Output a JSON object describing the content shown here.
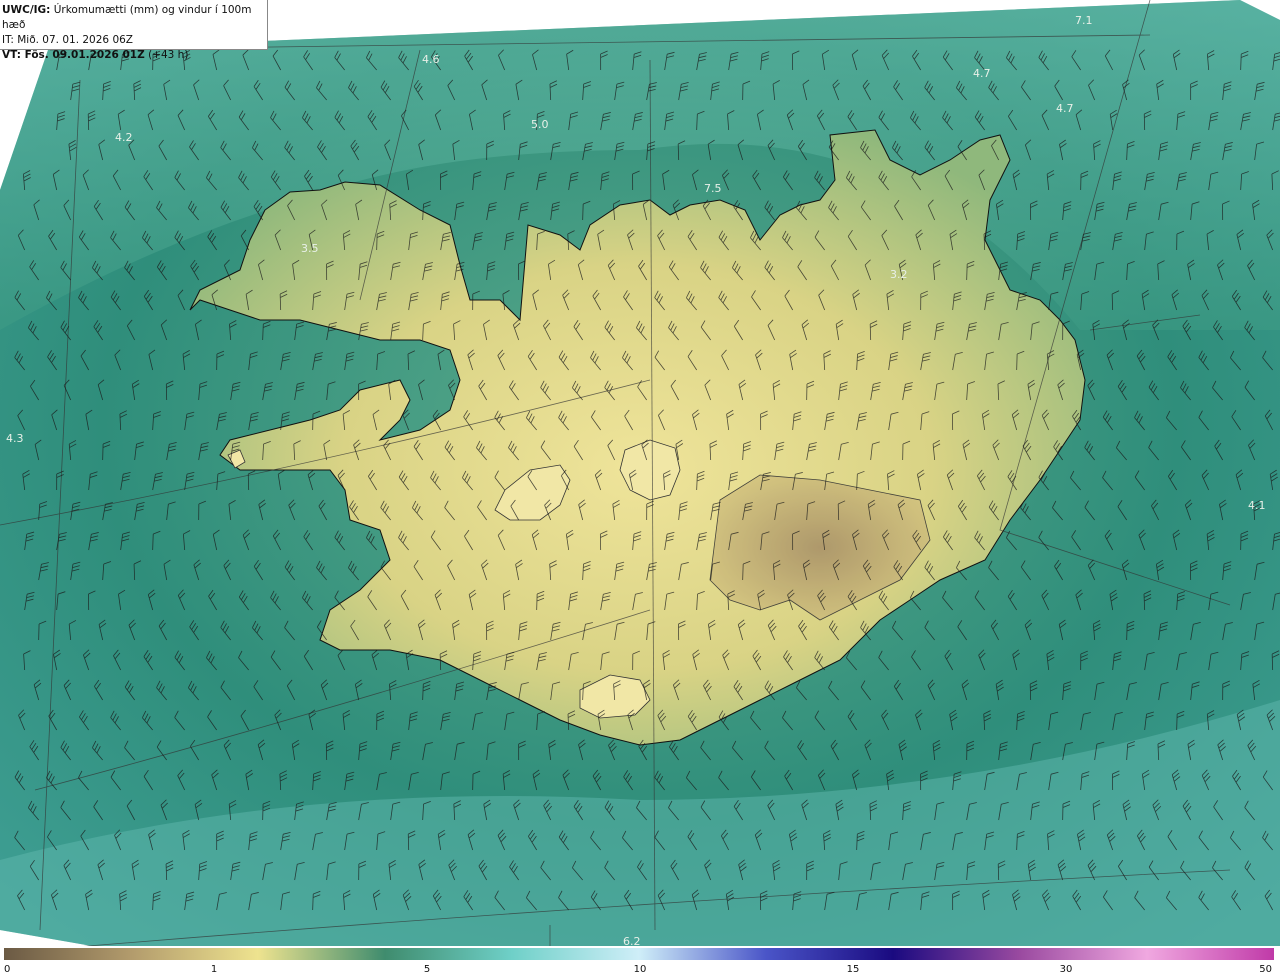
{
  "header": {
    "model": "UWC/IG:",
    "title": "Úrkomumætti (mm) og vindur í 100m hæð",
    "issue_time": "IT: Mið. 07. 01. 2026 06Z",
    "valid_prefix": "VT: Fös. 09.01.2026 01Z",
    "valid_suffix": "(+43 h)"
  },
  "map_labels": [
    {
      "text": "7.1",
      "lon": 0.84,
      "lat": 0.02
    },
    {
      "text": "4.6",
      "lon": 0.33,
      "lat": 0.06
    },
    {
      "text": "4.7",
      "lon": 0.76,
      "lat": 0.075
    },
    {
      "text": "4.7",
      "lon": 0.825,
      "lat": 0.11
    },
    {
      "text": "4.2",
      "lon": 0.09,
      "lat": 0.14
    },
    {
      "text": "5.0",
      "lon": 0.415,
      "lat": 0.127
    },
    {
      "text": "7.5",
      "lon": 0.55,
      "lat": 0.192
    },
    {
      "text": "3.5",
      "lon": 0.235,
      "lat": 0.254
    },
    {
      "text": "3.2",
      "lon": 0.695,
      "lat": 0.28
    },
    {
      "text": "4.3",
      "lon": 0.005,
      "lat": 0.448
    },
    {
      "text": "4.1",
      "lon": 0.975,
      "lat": 0.516
    },
    {
      "text": "6.2",
      "lon": 0.487,
      "lat": 0.962
    }
  ],
  "colorbar": {
    "ticks": [
      "0",
      "1",
      "5",
      "10",
      "15",
      "30",
      "50"
    ],
    "colors": [
      "#6b5a44",
      "#b29b6c",
      "#eee38f",
      "#3f8c6e",
      "#6fd0c8",
      "#cfeef8",
      "#4a55c8",
      "#1a0a80",
      "#9a4aa0",
      "#f0a8e0",
      "#c03aa8"
    ]
  },
  "style": {
    "sea_color": "#2f8e7b",
    "land_color": "#e4d98a",
    "coast_color": "#111111",
    "barb_color": "#1a1a1a"
  }
}
